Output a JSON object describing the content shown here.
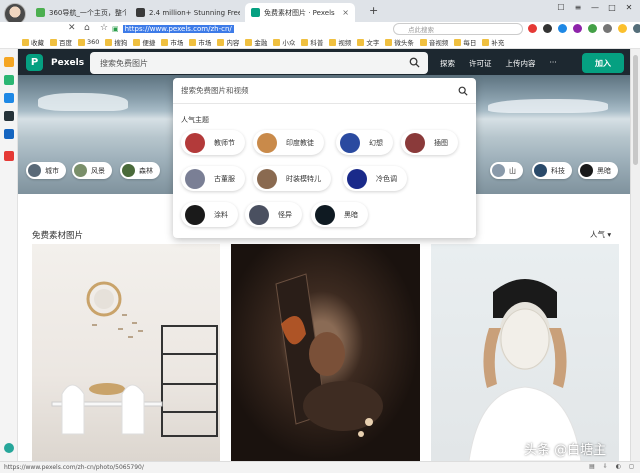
{
  "browser": {
    "tabs": [
      {
        "title": "360导航_一个主页，整个世界",
        "favicon_color": "#4caf50",
        "active": false
      },
      {
        "title": "2.4 million+ Stunning Free",
        "favicon_color": "#3a3a3a",
        "active": false
      },
      {
        "title": "免费素材图片 · Pexels",
        "favicon_color": "#05a081",
        "active": true
      }
    ],
    "url": "https://www.pexels.com/zh-cn/",
    "search_placeholder": "点此搜索",
    "bookmarks": [
      "收藏",
      "百度",
      "360",
      "搜狗",
      "便捷",
      "市场",
      "市场",
      "内容",
      "金融",
      "小众",
      "科普",
      "视频",
      "文字",
      "微头条",
      "音视频",
      "每日",
      "补充"
    ]
  },
  "site": {
    "brand": "Pexels",
    "search_placeholder": "搜索免费图片",
    "nav": {
      "explore": "探索",
      "license": "许可证",
      "upload": "上传内容",
      "more": "···",
      "join": "加入"
    },
    "chips": [
      "城市",
      "风景",
      "森林",
      "山",
      "科技",
      "黑暗"
    ],
    "dropdown": {
      "search_placeholder": "搜索免费图片和视频",
      "heading": "人气主题",
      "topics": [
        {
          "label": "教师节",
          "color": "#b33a3a"
        },
        {
          "label": "印度教徒",
          "color": "#c98a4a"
        },
        {
          "label": "幻想",
          "color": "#2a4aa0"
        },
        {
          "label": "插图",
          "color": "#8a3a3a"
        },
        {
          "label": "古董服",
          "color": "#7a7f95"
        },
        {
          "label": "时装模特儿",
          "color": "#8a6a50"
        },
        {
          "label": "冷色调",
          "color": "#1a2a8a"
        },
        {
          "label": "涂料",
          "color": "#1a1a1a"
        },
        {
          "label": "怪异",
          "color": "#4a5060"
        },
        {
          "label": "黑暗",
          "color": "#0f1a22"
        }
      ]
    },
    "section_title": "免费素材图片",
    "sort_label": "人气",
    "photos": [
      "interior-room",
      "woman-mirror-dark",
      "face-mask-woman"
    ]
  },
  "status": {
    "url": "https://www.pexels.com/zh-cn/photo/5065790/",
    "watermark": "头条 @白塘主"
  }
}
